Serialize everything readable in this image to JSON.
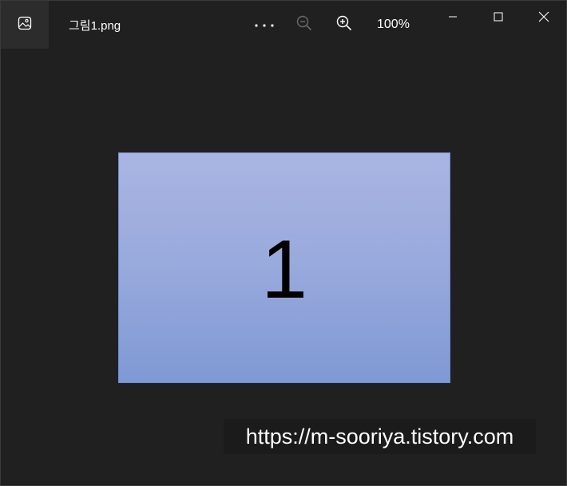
{
  "titlebar": {
    "app_icon": "photos-app-icon",
    "file_name": "그림1.png"
  },
  "toolbar": {
    "more_icon": "ellipsis-icon",
    "zoom_out_icon": "zoom-out-icon",
    "zoom_in_icon": "zoom-in-icon",
    "zoom_level": "100%"
  },
  "window_controls": {
    "minimize_icon": "minimize-icon",
    "maximize_icon": "maximize-icon",
    "close_icon": "close-icon"
  },
  "image": {
    "slide_text": "1"
  },
  "watermark": {
    "text": "https://m-sooriya.tistory.com"
  },
  "colors": {
    "background": "#202020",
    "slide_top": "#aab5e2",
    "slide_bottom": "#7f99d5",
    "slide_border": "#6f8fd4",
    "zoom_out_disabled": "#6b6b6b"
  }
}
